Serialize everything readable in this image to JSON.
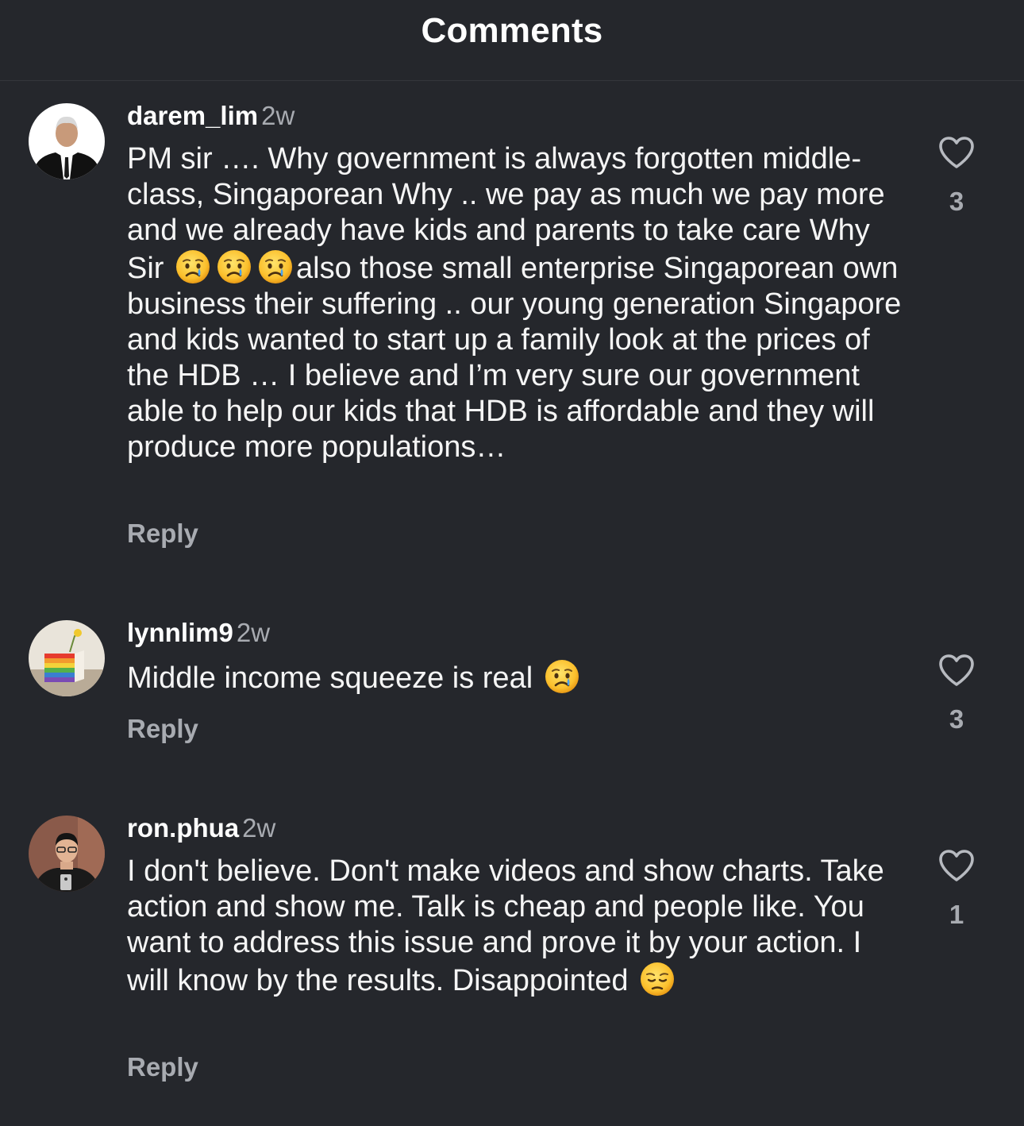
{
  "header": {
    "title": "Comments"
  },
  "comments": [
    {
      "username": "darem_lim",
      "time": "2w",
      "text_parts": [
        "PM sir …. Why government is always forgotten middle-class, Singaporean Why .. we pay as much we pay more and we already have kids and parents to take care Why Sir",
        "also those small enterprise Singaporean own business their suffering .. our young generation Singapore and kids wanted to start up a family look at the prices of the HDB … I believe and I’m very sure our government able to help our kids that HDB is affordable and they will produce more populations…"
      ],
      "emojis": [
        "crying-face",
        "crying-face",
        "crying-face"
      ],
      "reply_label": "Reply",
      "like_count": "3"
    },
    {
      "username": "lynnlim9",
      "time": "2w",
      "text": "Middle income squeeze is real",
      "emojis": [
        "crying-face"
      ],
      "reply_label": "Reply",
      "like_count": "3"
    },
    {
      "username": "ron.phua",
      "time": "2w",
      "text": "I don't believe. Don't make videos and show charts. Take action and show me. Talk is cheap and people like. You want to address this issue and prove it by your action. I will know by the results. Disappointed",
      "emojis": [
        "pensive-face"
      ],
      "reply_label": "Reply",
      "like_count": "1"
    }
  ],
  "colors": {
    "background": "#25272c",
    "text": "#f5f5f5",
    "muted": "#a8abb1",
    "divider": "#34363b"
  }
}
